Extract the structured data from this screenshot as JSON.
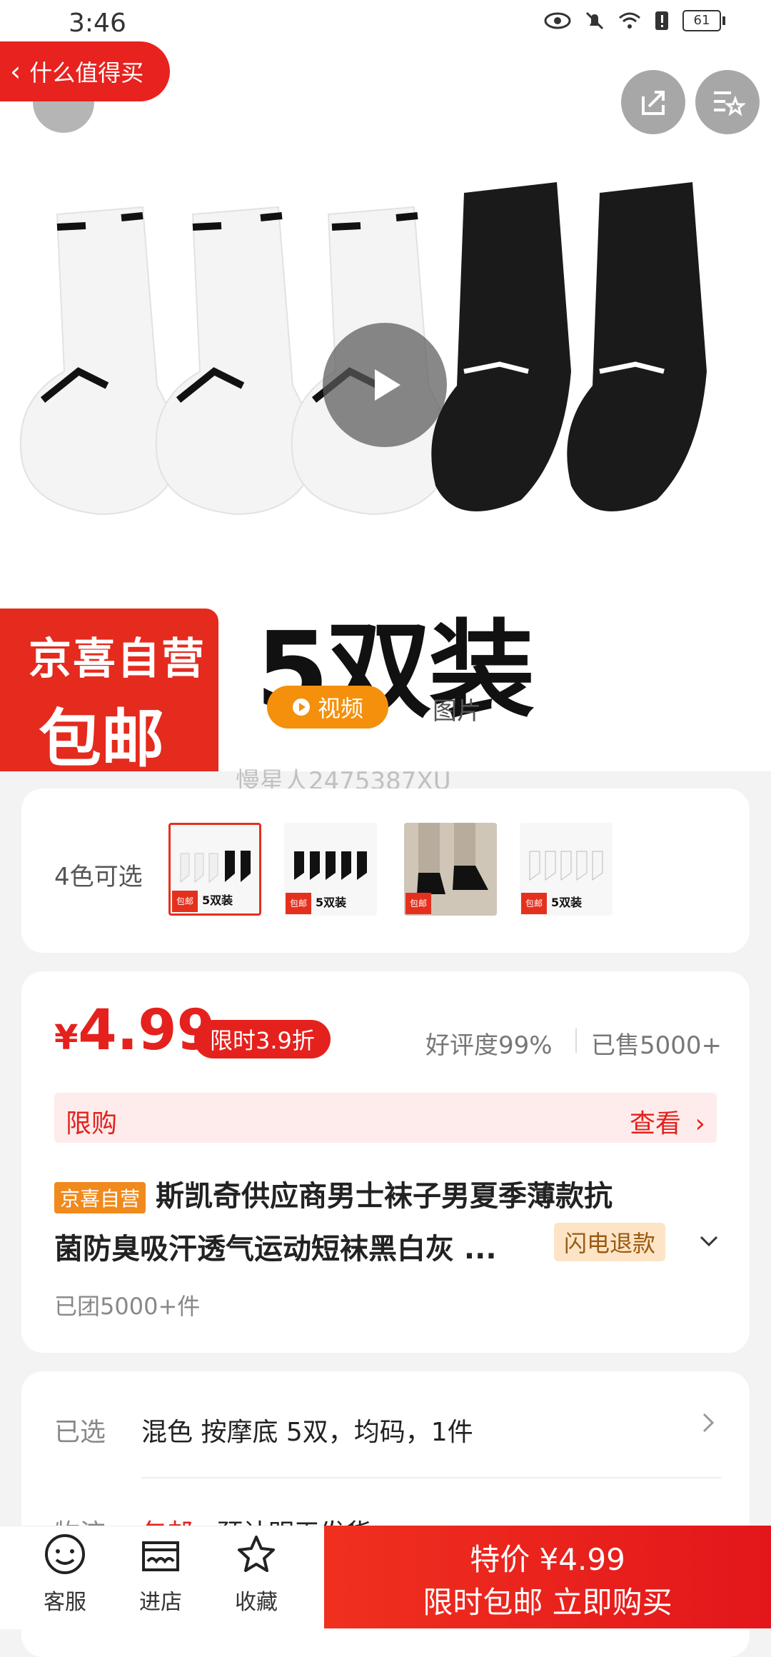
{
  "status_bar": {
    "time": "3:46",
    "battery": "61"
  },
  "back_pill": {
    "label": "什么值得买"
  },
  "hero": {
    "badge_top": "京喜自营",
    "badge_bottom": "包邮",
    "pack_text": "5双装",
    "video_label": "视频",
    "photo_label": "图片",
    "watermark": "慢星人2475387XU"
  },
  "colors": {
    "label": "4色可选",
    "thumbs": [
      {
        "tag": "包邮",
        "text": "5双装"
      },
      {
        "tag": "包邮",
        "text": "5双装"
      },
      {
        "tag": "包邮",
        "text": ""
      },
      {
        "tag": "包邮",
        "text": "5双装"
      }
    ]
  },
  "price": {
    "currency": "¥",
    "value": "4.99",
    "discount": "限时3.9折",
    "rating": "好评度99%",
    "sold": "已售5000+",
    "limit_label": "限购",
    "limit_action": "查看"
  },
  "product": {
    "tag": "京喜自营",
    "title_line1": "斯凯奇供应商男士袜子男夏季薄款抗",
    "title_line2": "菌防臭吸汗透气运动短袜黑白灰 ...",
    "flash_tag": "闪电退款",
    "group_sold": "已团5000+件"
  },
  "selected": {
    "label": "已选",
    "value": "混色 按摩底 5双，均码，1件",
    "ship_label": "物流",
    "ship_tag": "包邮",
    "ship_text": "预计明天发货"
  },
  "bottom": {
    "tabs": [
      {
        "label": "客服"
      },
      {
        "label": "进店"
      },
      {
        "label": "收藏"
      }
    ],
    "buy_line1": "特价 ¥4.99",
    "buy_line2": "限时包邮 立即购买"
  }
}
